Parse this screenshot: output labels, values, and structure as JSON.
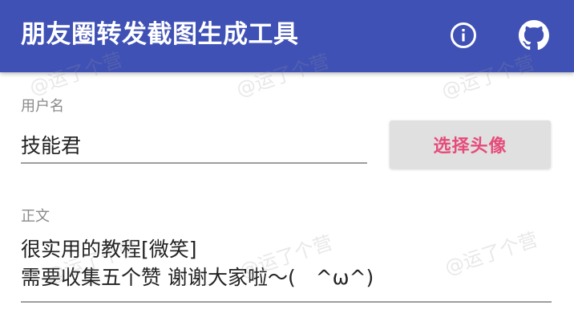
{
  "toolbar": {
    "title": "朋友圈转发截图生成工具",
    "info_icon": "info-circle-icon",
    "github_icon": "github-icon",
    "background_color": "#3f51b5"
  },
  "form": {
    "username": {
      "label": "用户名",
      "value": "技能君"
    },
    "avatar_button": {
      "label": "选择头像",
      "text_color": "#e64b7a"
    },
    "body": {
      "label": "正文",
      "lines": [
        "很实用的教程[微笑]",
        "需要收集五个赞 谢谢大家啦～(　^ω^)"
      ]
    }
  },
  "watermark": {
    "text": "@运了个营"
  }
}
